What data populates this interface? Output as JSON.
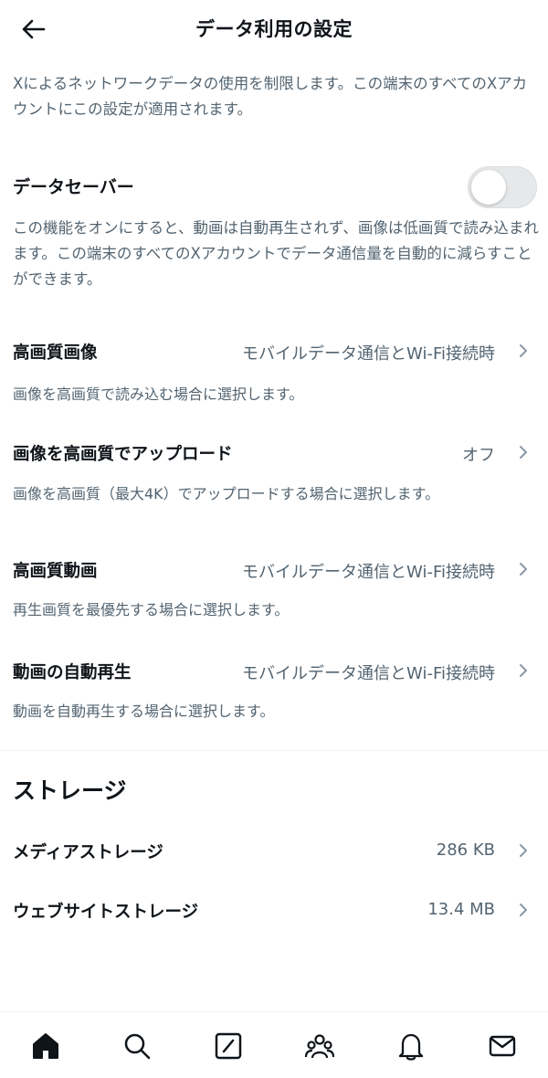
{
  "header": {
    "title": "データ利用の設定"
  },
  "intro": "Xによるネットワークデータの使用を制限します。この端末のすべてのXアカウントにこの設定が適用されます。",
  "data_saver": {
    "label": "データセーバー",
    "enabled": false,
    "description": "この機能をオンにすると、動画は自動再生されず、画像は低画質で読み込まれます。この端末のすべてのXアカウントでデータ通信量を自動的に減らすことができます。"
  },
  "settings": [
    {
      "label": "高画質画像",
      "value": "モバイルデータ通信とWi-Fi接続時",
      "description": "画像を高画質で読み込む場合に選択します。"
    },
    {
      "label": "画像を高画質でアップロード",
      "value": "オフ",
      "description": "画像を高画質（最大4K）でアップロードする場合に選択します。"
    },
    {
      "label": "高画質動画",
      "value": "モバイルデータ通信とWi-Fi接続時",
      "description": "再生画質を最優先する場合に選択します。"
    },
    {
      "label": "動画の自動再生",
      "value": "モバイルデータ通信とWi-Fi接続時",
      "description": "動画を自動再生する場合に選択します。"
    }
  ],
  "storage": {
    "title": "ストレージ",
    "items": [
      {
        "label": "メディアストレージ",
        "value": "286 KB"
      },
      {
        "label": "ウェブサイトストレージ",
        "value": "13.4 MB"
      }
    ]
  },
  "nav": {
    "icons": [
      "home-icon",
      "search-icon",
      "compose-icon",
      "communities-icon",
      "notifications-icon",
      "messages-icon"
    ]
  },
  "colors": {
    "text_primary": "#0f1419",
    "text_secondary": "#536471",
    "toggle_off": "#e6e8ea"
  }
}
